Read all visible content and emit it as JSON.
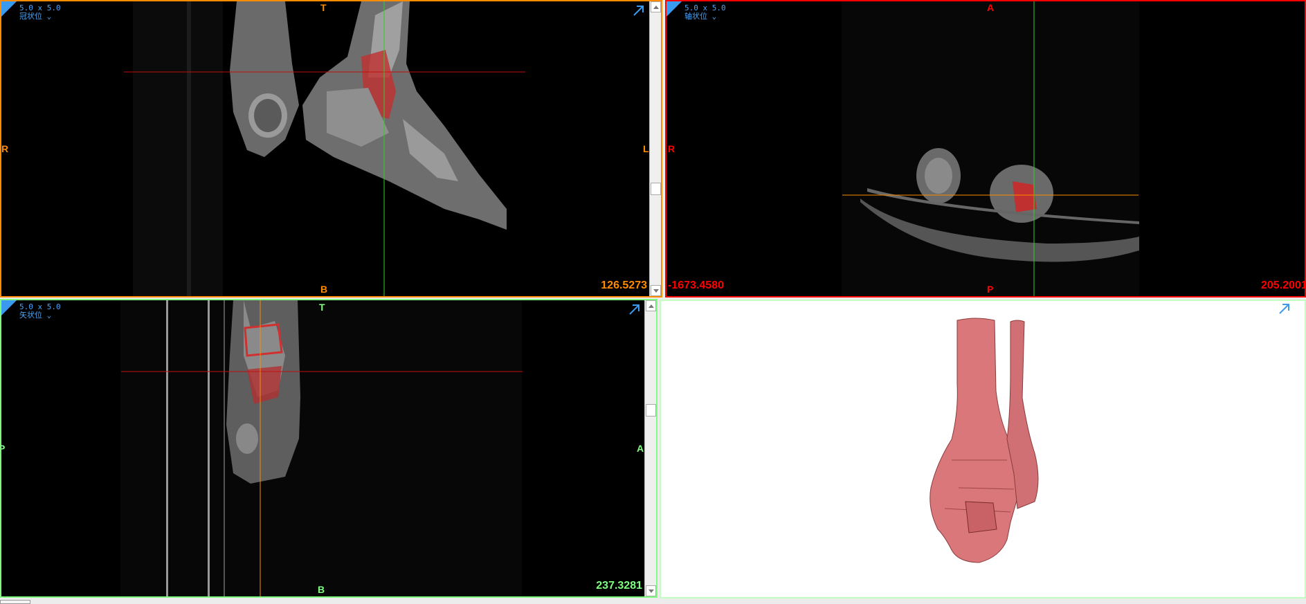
{
  "views": [
    {
      "id": "coronal",
      "thickness": "5.0 x 5.0",
      "plane": "冠状位",
      "top": "T",
      "bottom": "B",
      "left": "R",
      "right": "L",
      "value": "126.5273",
      "color": "#ff8c00"
    },
    {
      "id": "axial",
      "thickness": "5.0 x 5.0",
      "plane": "轴状位",
      "top": "A",
      "bottom": "P",
      "left": "R",
      "value_left": "-1673.4580",
      "value": "205.2001",
      "color": "#ff0000"
    },
    {
      "id": "sagittal",
      "thickness": "5.0 x 5.0",
      "plane": "矢状位",
      "top": "T",
      "bottom": "B",
      "left": "P",
      "right": "A",
      "value": "237.3281",
      "color": "#7fff7f"
    },
    {
      "id": "3d",
      "color": "#c0ffc0"
    }
  ],
  "icons": {
    "maximize": "maximize-arrow-icon",
    "dropdown": "chevron-down-icon"
  },
  "colors": {
    "accent": "#3a9af0",
    "bone3d": "#d9777a",
    "segmentation": "#ff3030"
  }
}
